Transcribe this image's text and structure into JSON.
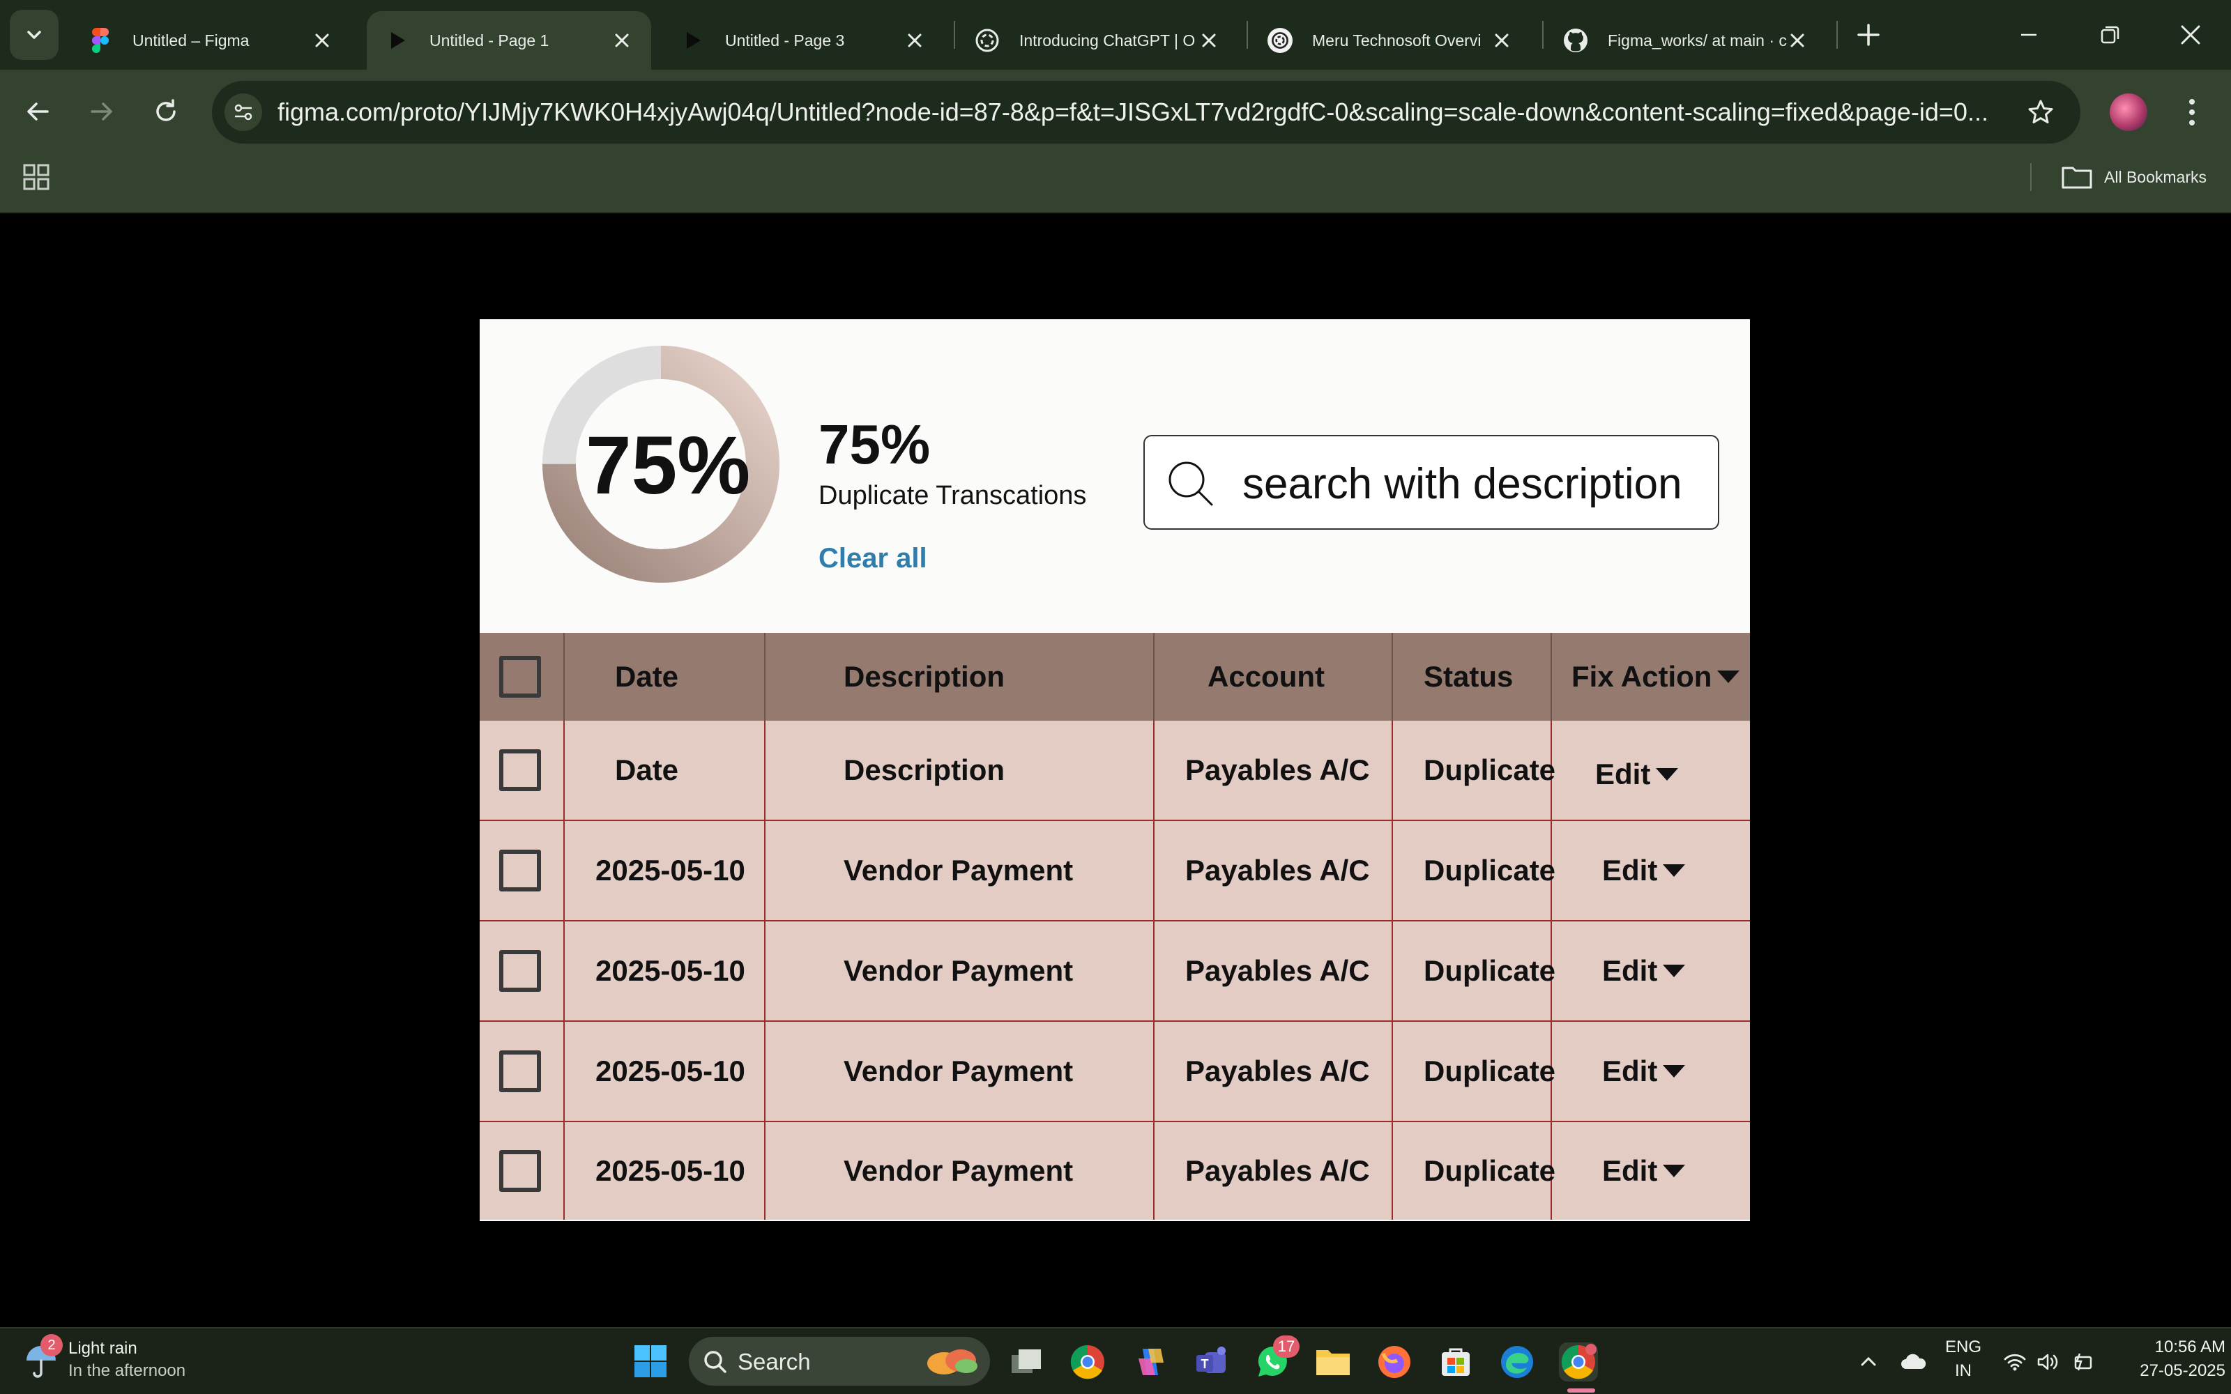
{
  "browser": {
    "tabs": [
      {
        "title": "Untitled – Figma",
        "favicon": "figma-icon",
        "active": false
      },
      {
        "title": "Untitled - Page 1",
        "favicon": "play-icon",
        "active": true
      },
      {
        "title": "Untitled - Page 3",
        "favicon": "play-icon",
        "active": false
      },
      {
        "title": "Introducing ChatGPT | O",
        "favicon": "openai-icon",
        "active": false
      },
      {
        "title": "Meru Technosoft Overvi",
        "favicon": "openai-icon",
        "active": false
      },
      {
        "title": "Figma_works/ at main · c",
        "favicon": "github-icon",
        "active": false
      }
    ],
    "url": "figma.com/proto/YIJMjy7KWK0H4xjyAwj04q/Untitled?node-id=87-8&p=f&t=JISGxLT7vd2rgdfC-0&scaling=scale-down&content-scaling=fixed&page-id=0...",
    "bookmarks_label": "All Bookmarks"
  },
  "dashboard": {
    "donut_percent": 75,
    "donut_label": "75%",
    "stat_value": "75%",
    "stat_label": "Duplicate Transcations",
    "clear_all": "Clear all",
    "search_placeholder": "search with description",
    "colors": {
      "ring_gradient_start": "#9a8278",
      "ring_gradient_end": "#e7d3cb",
      "ring_track": "#dedede",
      "header_bg": "#957a6f",
      "row_bg": "#e2ccc3",
      "row_divider": "#9b2a2a",
      "link": "#2e7dab"
    }
  },
  "table": {
    "headers": {
      "date": "Date",
      "description": "Description",
      "account": "Account",
      "status": "Status",
      "fix_action": "Fix Action"
    },
    "rows": [
      {
        "date": "Date",
        "description": "Description",
        "account": "Payables A/C",
        "status": "Duplicate",
        "action": "Edit"
      },
      {
        "date": "2025-05-10",
        "description": "Vendor Payment",
        "account": "Payables A/C",
        "status": "Duplicate",
        "action": "Edit"
      },
      {
        "date": "2025-05-10",
        "description": "Vendor Payment",
        "account": "Payables A/C",
        "status": "Duplicate",
        "action": "Edit"
      },
      {
        "date": "2025-05-10",
        "description": "Vendor Payment",
        "account": "Payables A/C",
        "status": "Duplicate",
        "action": "Edit"
      },
      {
        "date": "2025-05-10",
        "description": "Vendor Payment",
        "account": "Payables A/C",
        "status": "Duplicate",
        "action": "Edit"
      }
    ]
  },
  "taskbar": {
    "weather_badge": "2",
    "weather_title": "Light rain",
    "weather_sub": "In the afternoon",
    "search_label": "Search",
    "whatsapp_badge": "17",
    "lang_top": "ENG",
    "lang_bottom": "IN",
    "time": "10:56 AM",
    "date": "27-05-2025"
  }
}
